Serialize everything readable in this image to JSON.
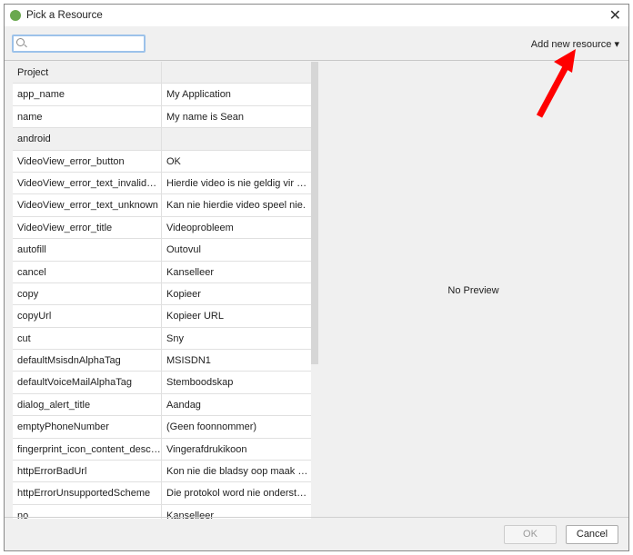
{
  "window": {
    "title": "Pick a Resource",
    "close_icon": "close-icon"
  },
  "toolbar": {
    "search_placeholder": "",
    "add_new_label": "Add new resource ▾"
  },
  "table": {
    "rows": [
      {
        "key": "Project",
        "value": "",
        "header": true
      },
      {
        "key": "app_name",
        "value": "My Application"
      },
      {
        "key": "name",
        "value": "My name is Sean"
      },
      {
        "key": "android",
        "value": "",
        "header": true
      },
      {
        "key": "VideoView_error_button",
        "value": "OK"
      },
      {
        "key": "VideoView_error_text_invalid_progressive_playback",
        "value": "Hierdie video is nie geldig vir stroming nie"
      },
      {
        "key": "VideoView_error_text_unknown",
        "value": "Kan nie hierdie video speel nie."
      },
      {
        "key": "VideoView_error_title",
        "value": "Videoprobleem"
      },
      {
        "key": "autofill",
        "value": "Outovul"
      },
      {
        "key": "cancel",
        "value": "Kanselleer"
      },
      {
        "key": "copy",
        "value": "Kopieer"
      },
      {
        "key": "copyUrl",
        "value": "Kopieer URL"
      },
      {
        "key": "cut",
        "value": "Sny"
      },
      {
        "key": "defaultMsisdnAlphaTag",
        "value": "MSISDN1"
      },
      {
        "key": "defaultVoiceMailAlphaTag",
        "value": "Stemboodskap"
      },
      {
        "key": "dialog_alert_title",
        "value": "Aandag"
      },
      {
        "key": "emptyPhoneNumber",
        "value": "(Geen foonnommer)"
      },
      {
        "key": "fingerprint_icon_content_description",
        "value": "Vingerafdrukikoon"
      },
      {
        "key": "httpErrorBadUrl",
        "value": "Kon nie die bladsy oop maak nie, want die URL is ongeldig."
      },
      {
        "key": "httpErrorUnsupportedScheme",
        "value": "Die protokol word nie ondersteun nie."
      },
      {
        "key": "no",
        "value": "Kanselleer"
      }
    ]
  },
  "preview": {
    "text": "No Preview"
  },
  "footer": {
    "ok_label": "OK",
    "cancel_label": "Cancel"
  }
}
